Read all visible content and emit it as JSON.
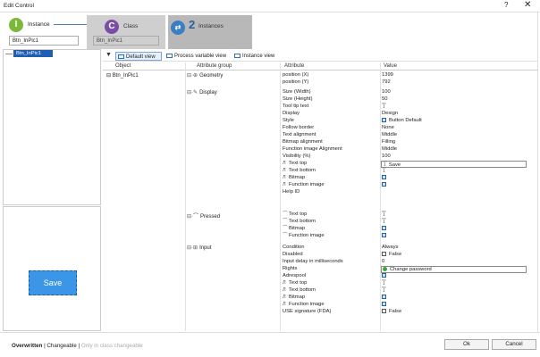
{
  "window": {
    "title": "Edit Control",
    "help": "?",
    "close": "✕"
  },
  "wizard": {
    "step1": {
      "number": "I",
      "label": "Instance",
      "value": "Btn_InPic1"
    },
    "step2": {
      "number": "C",
      "label": "Class",
      "value": "Btn_InPic1"
    },
    "step3": {
      "number": "2",
      "label": "Instances"
    }
  },
  "tree": {
    "selected": "Btn_InPic1"
  },
  "preview": {
    "button_label": "Save"
  },
  "toolbar": {
    "views": [
      "Default view",
      "Process variable view",
      "Instance view"
    ],
    "active": "Default view"
  },
  "grid": {
    "headers": {
      "object": "Object",
      "group": "Attribute group",
      "attribute": "Attribute",
      "value": "Value"
    },
    "object": "Btn_InPic1",
    "groups": [
      {
        "label": "Geometry",
        "icon": "geometry-icon"
      },
      {
        "label": "Display",
        "icon": "display-icon"
      },
      {
        "label": "Pressed",
        "icon": "pressed-icon"
      },
      {
        "label": "Input",
        "icon": "input-icon"
      }
    ],
    "rows": [
      {
        "attr": "position (X)",
        "val": "1399"
      },
      {
        "attr": "position (Y)",
        "val": "792"
      },
      {
        "attr": "Size (Width)",
        "val": "100"
      },
      {
        "attr": "Size (Height)",
        "val": "50"
      },
      {
        "attr": "Tool tip text",
        "val": "T"
      },
      {
        "attr": "Display",
        "val": "Design"
      },
      {
        "attr": "Style",
        "val": "Button Default"
      },
      {
        "attr": "Follow border",
        "val": "None"
      },
      {
        "attr": "Text alignment",
        "val": "Middle"
      },
      {
        "attr": "Bitmap alignment",
        "val": "Filling"
      },
      {
        "attr": "Function image Alignment",
        "val": "Middle"
      },
      {
        "attr": "Visibility (%)",
        "val": "100"
      },
      {
        "attr": "Text top",
        "val": "Save"
      },
      {
        "attr": "Text bottom",
        "val": "T"
      },
      {
        "attr": "Bitmap",
        "val": ""
      },
      {
        "attr": "Function image",
        "val": ""
      },
      {
        "attr": "Help ID",
        "val": ""
      },
      {
        "attr": "Text top",
        "val": "T"
      },
      {
        "attr": "Text bottom",
        "val": "T"
      },
      {
        "attr": "Bitmap",
        "val": ""
      },
      {
        "attr": "Function image",
        "val": ""
      },
      {
        "attr": "Condition",
        "val": "Always"
      },
      {
        "attr": "Disabled",
        "val": "False"
      },
      {
        "attr": "Input delay in milliseconds",
        "val": "0"
      },
      {
        "attr": "Rights",
        "val": "Change password"
      },
      {
        "attr": "Adrespool",
        "val": ""
      },
      {
        "attr": "Text top",
        "val": "T"
      },
      {
        "attr": "Text bottom",
        "val": "T"
      },
      {
        "attr": "Bitmap",
        "val": ""
      },
      {
        "attr": "Function image",
        "val": ""
      },
      {
        "attr": "USE signature (FDA)",
        "val": "False"
      }
    ]
  },
  "footer": {
    "overwritten": "Overwritten",
    "changeable": "Changeable",
    "class_changeable": "Only in class changeable",
    "ok": "Ok",
    "cancel": "Cancel"
  }
}
